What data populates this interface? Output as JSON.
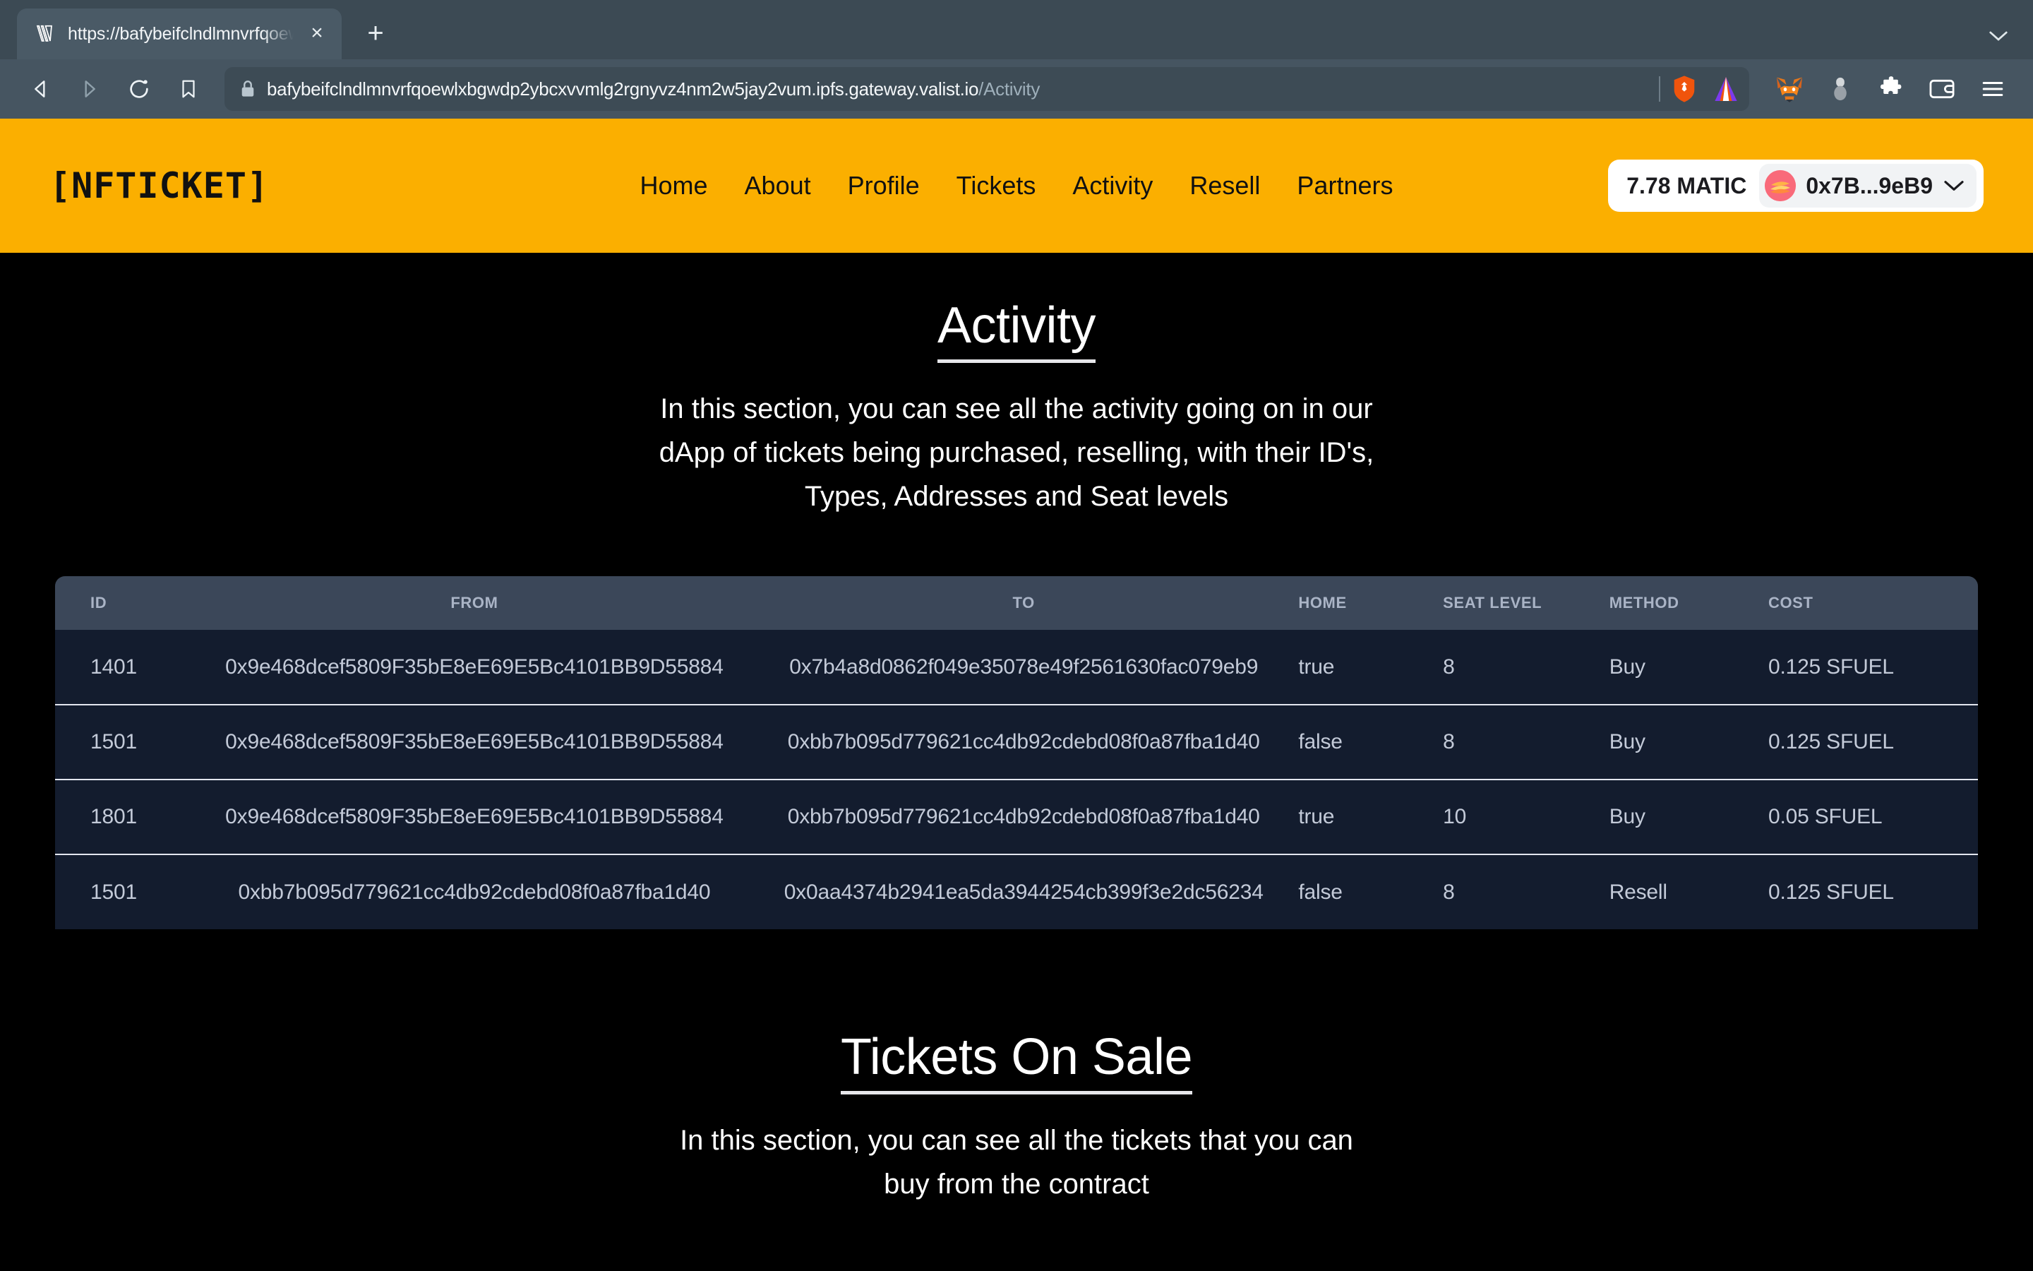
{
  "browser": {
    "tab": {
      "favicon": "valist-v-icon",
      "title": "https://bafybeifclndlmnvrfqoew",
      "close_label": "×"
    },
    "new_tab_label": "+",
    "tabstrip_chevron": "chevron-down-icon",
    "nav": {
      "back": "back-arrow-icon",
      "forward": "forward-arrow-icon",
      "reload": "reload-icon",
      "bookmark": "bookmark-icon"
    },
    "omnibox": {
      "lock": "lock-icon",
      "url_host": "bafybeifclndlmnvrfqoewlxbgwdp2ybcxvvmlg2rgnyvz4nm2w5jay2vum.ipfs.gateway.valist.io",
      "url_path": "/Activity"
    },
    "toolbar_icons": [
      "brave-shields-icon",
      "brave-leo-icon",
      "metamask-fox-icon",
      "wallet-badge-icon",
      "extensions-puzzle-icon",
      "wallet-icon",
      "hamburger-menu-icon"
    ]
  },
  "site": {
    "brand": "[NFTICKET]",
    "nav_items": [
      {
        "label": "Home"
      },
      {
        "label": "About"
      },
      {
        "label": "Profile"
      },
      {
        "label": "Tickets"
      },
      {
        "label": "Activity"
      },
      {
        "label": "Resell"
      },
      {
        "label": "Partners"
      }
    ],
    "wallet": {
      "balance": "7.78 MATIC",
      "address": "0x7B...9eB9",
      "avatar_color": "#f96a7a",
      "chevron": "chevron-down-icon"
    },
    "accent_color": "#FBAF00",
    "background_color": "#000000"
  },
  "activity_section": {
    "title": "Activity",
    "description": "In this section, you can see all the activity going on in our dApp of tickets being purchased, reselling, with their ID's, Types, Addresses and Seat levels"
  },
  "activity_table": {
    "columns": [
      "ID",
      "FROM",
      "TO",
      "HOME",
      "SEAT LEVEL",
      "METHOD",
      "COST"
    ],
    "rows": [
      {
        "id": "1401",
        "from": "0x9e468dcef5809F35bE8eE69E5Bc4101BB9D55884",
        "to": "0x7b4a8d0862f049e35078e49f2561630fac079eb9",
        "home": "true",
        "seat_level": "8",
        "method": "Buy",
        "cost": "0.125 SFUEL"
      },
      {
        "id": "1501",
        "from": "0x9e468dcef5809F35bE8eE69E5Bc4101BB9D55884",
        "to": "0xbb7b095d779621cc4db92cdebd08f0a87fba1d40",
        "home": "false",
        "seat_level": "8",
        "method": "Buy",
        "cost": "0.125 SFUEL"
      },
      {
        "id": "1801",
        "from": "0x9e468dcef5809F35bE8eE69E5Bc4101BB9D55884",
        "to": "0xbb7b095d779621cc4db92cdebd08f0a87fba1d40",
        "home": "true",
        "seat_level": "10",
        "method": "Buy",
        "cost": "0.05 SFUEL"
      },
      {
        "id": "1501",
        "from": "0xbb7b095d779621cc4db92cdebd08f0a87fba1d40",
        "to": "0x0aa4374b2941ea5da3944254cb399f3e2dc56234",
        "home": "false",
        "seat_level": "8",
        "method": "Resell",
        "cost": "0.125 SFUEL"
      }
    ]
  },
  "sale_section": {
    "title": "Tickets On Sale",
    "description": "In this section, you can see all the tickets that you can buy from the contract"
  }
}
